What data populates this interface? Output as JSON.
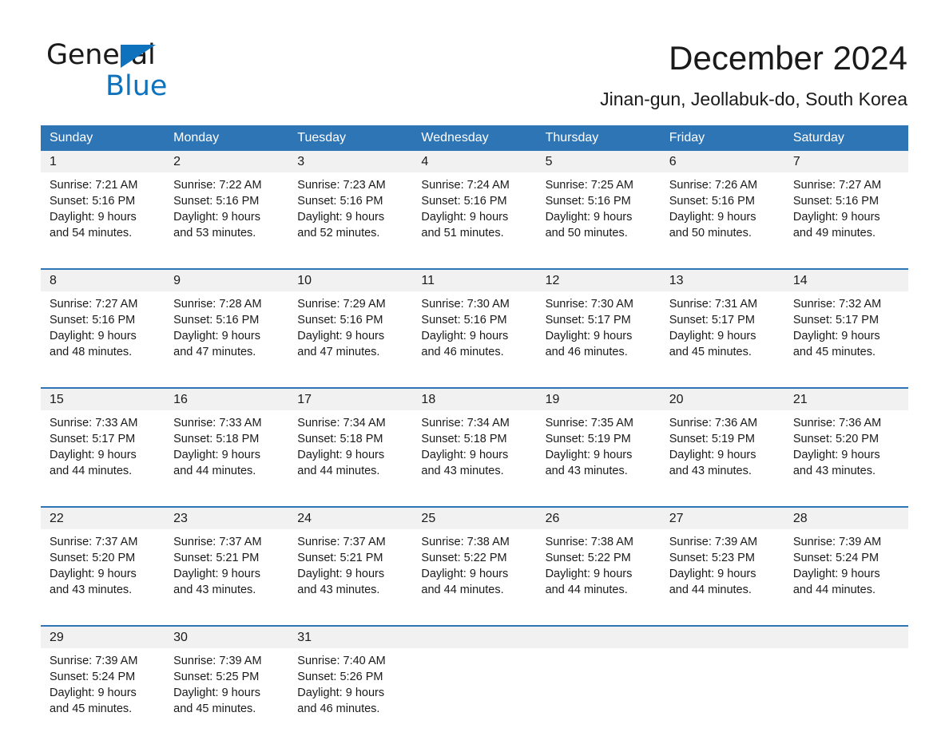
{
  "brand": {
    "logo_line1": "General",
    "logo_line2": "Blue",
    "logo_triangle_color": "#0f72bd"
  },
  "header": {
    "month_title": "December 2024",
    "location": "Jinan-gun, Jeollabuk-do, South Korea"
  },
  "colors": {
    "header_blue": "#2e75b6",
    "daynum_band": "#f1f1f1",
    "text": "#1a1a1a",
    "white": "#ffffff"
  },
  "calendar": {
    "weekday_headers": [
      "Sunday",
      "Monday",
      "Tuesday",
      "Wednesday",
      "Thursday",
      "Friday",
      "Saturday"
    ],
    "weeks": [
      {
        "days": [
          {
            "num": "1",
            "sunrise": "Sunrise: 7:21 AM",
            "sunset": "Sunset: 5:16 PM",
            "daylight1": "Daylight: 9 hours",
            "daylight2": "and 54 minutes."
          },
          {
            "num": "2",
            "sunrise": "Sunrise: 7:22 AM",
            "sunset": "Sunset: 5:16 PM",
            "daylight1": "Daylight: 9 hours",
            "daylight2": "and 53 minutes."
          },
          {
            "num": "3",
            "sunrise": "Sunrise: 7:23 AM",
            "sunset": "Sunset: 5:16 PM",
            "daylight1": "Daylight: 9 hours",
            "daylight2": "and 52 minutes."
          },
          {
            "num": "4",
            "sunrise": "Sunrise: 7:24 AM",
            "sunset": "Sunset: 5:16 PM",
            "daylight1": "Daylight: 9 hours",
            "daylight2": "and 51 minutes."
          },
          {
            "num": "5",
            "sunrise": "Sunrise: 7:25 AM",
            "sunset": "Sunset: 5:16 PM",
            "daylight1": "Daylight: 9 hours",
            "daylight2": "and 50 minutes."
          },
          {
            "num": "6",
            "sunrise": "Sunrise: 7:26 AM",
            "sunset": "Sunset: 5:16 PM",
            "daylight1": "Daylight: 9 hours",
            "daylight2": "and 50 minutes."
          },
          {
            "num": "7",
            "sunrise": "Sunrise: 7:27 AM",
            "sunset": "Sunset: 5:16 PM",
            "daylight1": "Daylight: 9 hours",
            "daylight2": "and 49 minutes."
          }
        ]
      },
      {
        "days": [
          {
            "num": "8",
            "sunrise": "Sunrise: 7:27 AM",
            "sunset": "Sunset: 5:16 PM",
            "daylight1": "Daylight: 9 hours",
            "daylight2": "and 48 minutes."
          },
          {
            "num": "9",
            "sunrise": "Sunrise: 7:28 AM",
            "sunset": "Sunset: 5:16 PM",
            "daylight1": "Daylight: 9 hours",
            "daylight2": "and 47 minutes."
          },
          {
            "num": "10",
            "sunrise": "Sunrise: 7:29 AM",
            "sunset": "Sunset: 5:16 PM",
            "daylight1": "Daylight: 9 hours",
            "daylight2": "and 47 minutes."
          },
          {
            "num": "11",
            "sunrise": "Sunrise: 7:30 AM",
            "sunset": "Sunset: 5:16 PM",
            "daylight1": "Daylight: 9 hours",
            "daylight2": "and 46 minutes."
          },
          {
            "num": "12",
            "sunrise": "Sunrise: 7:30 AM",
            "sunset": "Sunset: 5:17 PM",
            "daylight1": "Daylight: 9 hours",
            "daylight2": "and 46 minutes."
          },
          {
            "num": "13",
            "sunrise": "Sunrise: 7:31 AM",
            "sunset": "Sunset: 5:17 PM",
            "daylight1": "Daylight: 9 hours",
            "daylight2": "and 45 minutes."
          },
          {
            "num": "14",
            "sunrise": "Sunrise: 7:32 AM",
            "sunset": "Sunset: 5:17 PM",
            "daylight1": "Daylight: 9 hours",
            "daylight2": "and 45 minutes."
          }
        ]
      },
      {
        "days": [
          {
            "num": "15",
            "sunrise": "Sunrise: 7:33 AM",
            "sunset": "Sunset: 5:17 PM",
            "daylight1": "Daylight: 9 hours",
            "daylight2": "and 44 minutes."
          },
          {
            "num": "16",
            "sunrise": "Sunrise: 7:33 AM",
            "sunset": "Sunset: 5:18 PM",
            "daylight1": "Daylight: 9 hours",
            "daylight2": "and 44 minutes."
          },
          {
            "num": "17",
            "sunrise": "Sunrise: 7:34 AM",
            "sunset": "Sunset: 5:18 PM",
            "daylight1": "Daylight: 9 hours",
            "daylight2": "and 44 minutes."
          },
          {
            "num": "18",
            "sunrise": "Sunrise: 7:34 AM",
            "sunset": "Sunset: 5:18 PM",
            "daylight1": "Daylight: 9 hours",
            "daylight2": "and 43 minutes."
          },
          {
            "num": "19",
            "sunrise": "Sunrise: 7:35 AM",
            "sunset": "Sunset: 5:19 PM",
            "daylight1": "Daylight: 9 hours",
            "daylight2": "and 43 minutes."
          },
          {
            "num": "20",
            "sunrise": "Sunrise: 7:36 AM",
            "sunset": "Sunset: 5:19 PM",
            "daylight1": "Daylight: 9 hours",
            "daylight2": "and 43 minutes."
          },
          {
            "num": "21",
            "sunrise": "Sunrise: 7:36 AM",
            "sunset": "Sunset: 5:20 PM",
            "daylight1": "Daylight: 9 hours",
            "daylight2": "and 43 minutes."
          }
        ]
      },
      {
        "days": [
          {
            "num": "22",
            "sunrise": "Sunrise: 7:37 AM",
            "sunset": "Sunset: 5:20 PM",
            "daylight1": "Daylight: 9 hours",
            "daylight2": "and 43 minutes."
          },
          {
            "num": "23",
            "sunrise": "Sunrise: 7:37 AM",
            "sunset": "Sunset: 5:21 PM",
            "daylight1": "Daylight: 9 hours",
            "daylight2": "and 43 minutes."
          },
          {
            "num": "24",
            "sunrise": "Sunrise: 7:37 AM",
            "sunset": "Sunset: 5:21 PM",
            "daylight1": "Daylight: 9 hours",
            "daylight2": "and 43 minutes."
          },
          {
            "num": "25",
            "sunrise": "Sunrise: 7:38 AM",
            "sunset": "Sunset: 5:22 PM",
            "daylight1": "Daylight: 9 hours",
            "daylight2": "and 44 minutes."
          },
          {
            "num": "26",
            "sunrise": "Sunrise: 7:38 AM",
            "sunset": "Sunset: 5:22 PM",
            "daylight1": "Daylight: 9 hours",
            "daylight2": "and 44 minutes."
          },
          {
            "num": "27",
            "sunrise": "Sunrise: 7:39 AM",
            "sunset": "Sunset: 5:23 PM",
            "daylight1": "Daylight: 9 hours",
            "daylight2": "and 44 minutes."
          },
          {
            "num": "28",
            "sunrise": "Sunrise: 7:39 AM",
            "sunset": "Sunset: 5:24 PM",
            "daylight1": "Daylight: 9 hours",
            "daylight2": "and 44 minutes."
          }
        ]
      },
      {
        "days": [
          {
            "num": "29",
            "sunrise": "Sunrise: 7:39 AM",
            "sunset": "Sunset: 5:24 PM",
            "daylight1": "Daylight: 9 hours",
            "daylight2": "and 45 minutes."
          },
          {
            "num": "30",
            "sunrise": "Sunrise: 7:39 AM",
            "sunset": "Sunset: 5:25 PM",
            "daylight1": "Daylight: 9 hours",
            "daylight2": "and 45 minutes."
          },
          {
            "num": "31",
            "sunrise": "Sunrise: 7:40 AM",
            "sunset": "Sunset: 5:26 PM",
            "daylight1": "Daylight: 9 hours",
            "daylight2": "and 46 minutes."
          },
          {
            "num": "",
            "sunrise": "",
            "sunset": "",
            "daylight1": "",
            "daylight2": ""
          },
          {
            "num": "",
            "sunrise": "",
            "sunset": "",
            "daylight1": "",
            "daylight2": ""
          },
          {
            "num": "",
            "sunrise": "",
            "sunset": "",
            "daylight1": "",
            "daylight2": ""
          },
          {
            "num": "",
            "sunrise": "",
            "sunset": "",
            "daylight1": "",
            "daylight2": ""
          }
        ]
      }
    ]
  }
}
